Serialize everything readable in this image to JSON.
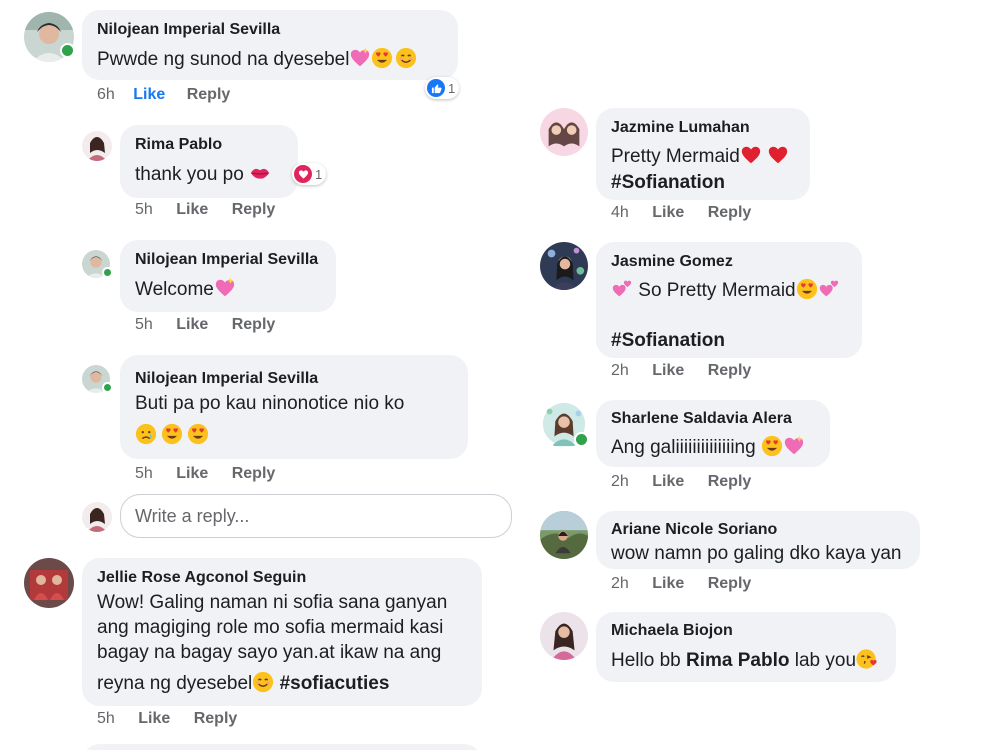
{
  "colors": {
    "bubble": "#f0f2f5",
    "link_blue": "#1877f2",
    "meta_gray": "#65676b",
    "online": "#31a24c",
    "love_red": "#e0245e"
  },
  "left_thread": {
    "c1": {
      "author": "Nilojean Imperial Sevilla",
      "text": "Pwwde ng sunod na dyesebel",
      "time": "6h",
      "like": "Like",
      "reply": "Reply",
      "reactions": "1",
      "reaction_icon": "thumbs-up-icon"
    },
    "c2": {
      "author": "Rima Pablo",
      "text": "thank you po",
      "time": "5h",
      "like": "Like",
      "reply": "Reply",
      "reactions": "1",
      "reaction_icon": "heart-icon"
    },
    "c3": {
      "author": "Nilojean Imperial Sevilla",
      "text": "Welcome",
      "time": "5h",
      "like": "Like",
      "reply": "Reply"
    },
    "c4": {
      "author": "Nilojean Imperial Sevilla",
      "text": "Buti pa po kau ninonotice nio ko",
      "time": "5h",
      "like": "Like",
      "reply": "Reply"
    },
    "reply_input": {
      "placeholder": "Write a reply..."
    },
    "c5": {
      "author": "Jellie Rose Agconol Seguin",
      "line1": "Wow! Galing naman ni sofia sana ganyan",
      "line2": "ang magiging role mo sofia mermaid kasi",
      "line3": "bagay na bagay sayo yan.at ikaw na ang",
      "line4_a": "reyna ng dyesebel",
      "line4_tag": "#sofiacuties",
      "time": "5h",
      "like": "Like",
      "reply": "Reply"
    }
  },
  "right_thread": {
    "c1": {
      "author": "Jazmine Lumahan",
      "text": "Pretty Mermaid",
      "tag": "#Sofianation",
      "time": "4h",
      "like": "Like",
      "reply": "Reply"
    },
    "c2": {
      "author": "Jasmine Gomez",
      "text": "So Pretty Mermaid",
      "tag": "#Sofianation",
      "time": "2h",
      "like": "Like",
      "reply": "Reply"
    },
    "c3": {
      "author": "Sharlene Saldavia Alera",
      "text": "Ang galiiiiiiiiiiiiiing",
      "time": "2h",
      "like": "Like",
      "reply": "Reply"
    },
    "c4": {
      "author": "Ariane Nicole Soriano",
      "text": "wow namn po galing dko kaya yan",
      "time": "2h",
      "like": "Like",
      "reply": "Reply"
    },
    "c5": {
      "author": "Michaela Biojon",
      "text_a": "Hello bb ",
      "mention": "Rima Pablo",
      "text_b": " lab you"
    }
  }
}
